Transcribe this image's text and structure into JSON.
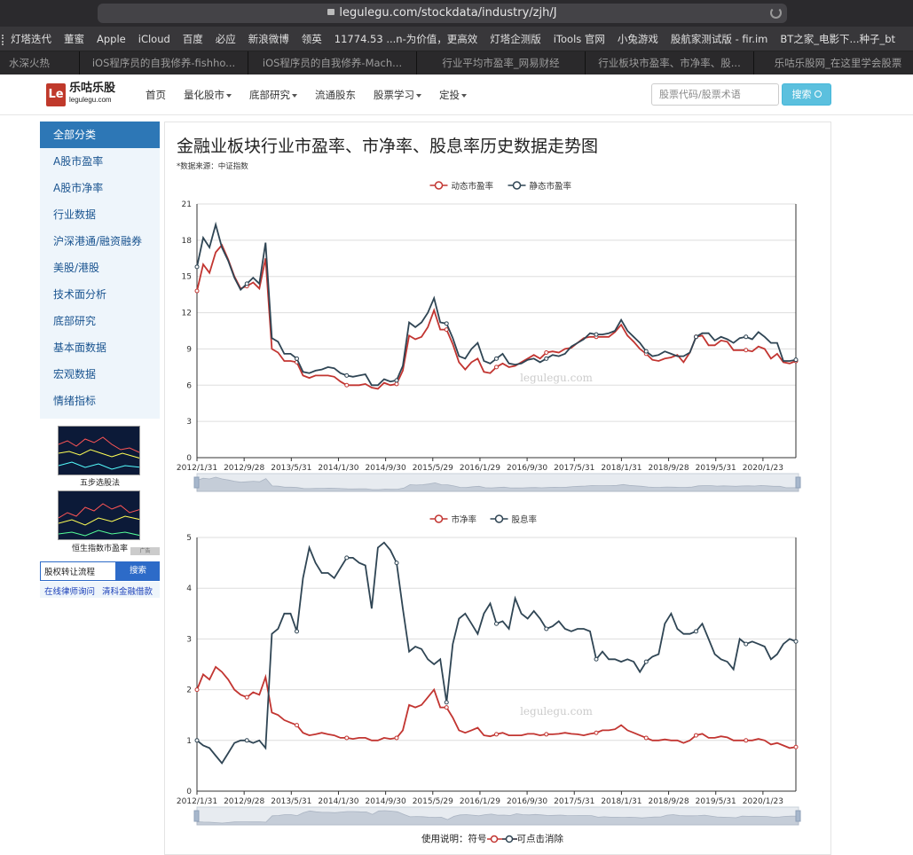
{
  "browser": {
    "url": "legulegu.com/stockdata/industry/zjh/J",
    "bookmarks": [
      "灯塔迭代",
      "董蜜",
      "Apple",
      "iCloud",
      "百度",
      "必应",
      "新浪微博",
      "领英",
      "11774.53 ...n-为价值，更高效",
      "灯塔企测版",
      "iTools 官网",
      "小兔游戏",
      "股航家测试版 - fir.im",
      "BT之家_电影下...种子_bt"
    ],
    "tabs": [
      "水深火热",
      "iOS程序员的自我修养-fishho...",
      "iOS程序员的自我修养-Mach...",
      "行业平均市盈率_网易财经",
      "行业板块市盈率、市净率、股...",
      "乐咕乐股网_在这里学会股票"
    ]
  },
  "site": {
    "logo_mark": "Le",
    "logo_text": "乐咕乐股",
    "logo_sub": "legulegu.com",
    "nav": [
      {
        "label": "首页"
      },
      {
        "label": "量化股市"
      },
      {
        "label": "底部研究"
      },
      {
        "label": "流通股东"
      },
      {
        "label": "股票学习"
      },
      {
        "label": "定投"
      }
    ],
    "search_placeholder": "股票代码/股票术语",
    "search_button": "搜索"
  },
  "sidebar": {
    "header": "全部分类",
    "items": [
      "A股市盈率",
      "A股市净率",
      "行业数据",
      "沪深港通/融资融券",
      "美股/港股",
      "技术面分析",
      "底部研究",
      "基本面数据",
      "宏观数据",
      "情绪指标"
    ],
    "ads": [
      {
        "caption": "五步选股法"
      },
      {
        "caption": "恒生指数市盈率"
      }
    ],
    "ad_badge": "广告",
    "search_input_value": "股权转让流程",
    "search_button": "搜索",
    "link1": "在线律师询问",
    "link2": "清科金融借款"
  },
  "main": {
    "title": "金融业板块行业市盈率、市净率、股息率历史数据走势图",
    "data_source": "*数据来源：中证指数",
    "watermark": "legulegu.com",
    "usage_note_prefix": "使用说明：符号",
    "usage_note_suffix": "可点击消除"
  },
  "colors": {
    "red": "#c23531",
    "dark": "#2f4554",
    "accent": "#2d77b6"
  },
  "chart_data": [
    {
      "type": "line",
      "title": "",
      "x_labels": [
        "2012/1/31",
        "2012/9/28",
        "2013/5/31",
        "2014/1/30",
        "2014/9/30",
        "2015/5/29",
        "2016/1/29",
        "2016/9/30",
        "2017/5/31",
        "2018/1/31",
        "2018/9/28",
        "2019/5/31",
        "2020/1/23"
      ],
      "ylim": [
        0,
        21
      ],
      "yticks": [
        0,
        3,
        6,
        9,
        12,
        15,
        18,
        21
      ],
      "legend_position": "top-center",
      "series": [
        {
          "name": "动态市盈率",
          "color": "#c23531",
          "values": [
            13.8,
            16.0,
            15.3,
            17.0,
            17.6,
            16.4,
            15.0,
            14.0,
            14.2,
            14.5,
            14.0,
            16.5,
            9.0,
            8.7,
            8.0,
            8.0,
            7.9,
            6.8,
            6.6,
            6.8,
            6.8,
            6.8,
            6.7,
            6.3,
            6.0,
            6.0,
            6.0,
            6.1,
            5.8,
            5.7,
            6.2,
            6.0,
            6.1,
            7.2,
            10.1,
            9.8,
            10.0,
            10.8,
            12.2,
            10.6,
            10.6,
            9.4,
            7.9,
            7.3,
            7.9,
            8.2,
            7.1,
            7.0,
            7.5,
            7.8,
            7.5,
            7.6,
            7.9,
            8.2,
            8.5,
            8.2,
            8.7,
            8.8,
            8.7,
            9.0,
            9.1,
            9.5,
            9.9,
            10.0,
            10.0,
            10.0,
            10.0,
            10.4,
            11.0,
            10.1,
            9.6,
            9.0,
            8.6,
            8.1,
            8.0,
            8.2,
            8.3,
            8.5,
            7.9,
            8.7,
            10.0,
            10.1,
            9.3,
            9.3,
            9.7,
            9.6,
            8.9,
            8.9,
            8.9,
            8.8,
            9.2,
            9.0,
            8.2,
            8.6,
            7.9,
            7.8,
            8.0
          ]
        },
        {
          "name": "静态市盈率",
          "color": "#2f4554",
          "values": [
            15.8,
            18.2,
            17.4,
            19.3,
            17.4,
            16.3,
            14.9,
            13.9,
            14.4,
            14.9,
            14.4,
            17.8,
            9.9,
            9.6,
            8.6,
            8.6,
            8.2,
            7.1,
            7.0,
            7.2,
            7.3,
            7.5,
            7.4,
            7.0,
            6.8,
            6.7,
            6.8,
            6.9,
            6.0,
            6.0,
            6.5,
            6.3,
            6.4,
            7.6,
            11.2,
            10.8,
            11.2,
            12.0,
            13.2,
            11.2,
            11.1,
            9.9,
            8.4,
            8.2,
            9.0,
            9.5,
            8.0,
            7.8,
            8.2,
            8.6,
            7.8,
            7.7,
            7.8,
            8.1,
            8.2,
            7.9,
            8.2,
            8.5,
            8.4,
            8.6,
            9.2,
            9.5,
            9.8,
            10.3,
            10.2,
            10.2,
            10.3,
            10.5,
            11.4,
            10.5,
            10.0,
            9.5,
            8.8,
            8.4,
            8.5,
            8.8,
            8.6,
            8.4,
            8.4,
            8.7,
            10.0,
            10.3,
            10.3,
            9.7,
            10.0,
            9.8,
            9.5,
            9.9,
            10.0,
            9.8,
            10.4,
            10.0,
            9.5,
            9.5,
            8.0,
            8.0,
            8.1
          ]
        }
      ]
    },
    {
      "type": "line",
      "title": "",
      "x_labels": [
        "2012/1/31",
        "2012/9/28",
        "2013/5/31",
        "2014/1/30",
        "2014/9/30",
        "2015/5/29",
        "2016/1/29",
        "2016/9/30",
        "2017/5/31",
        "2018/1/31",
        "2018/9/28",
        "2019/5/31",
        "2020/1/23"
      ],
      "ylim": [
        0,
        5
      ],
      "yticks": [
        0,
        1,
        2,
        3,
        4,
        5
      ],
      "legend_position": "top-center",
      "series": [
        {
          "name": "市净率",
          "color": "#c23531",
          "values": [
            2.0,
            2.3,
            2.2,
            2.45,
            2.35,
            2.2,
            2.0,
            1.9,
            1.85,
            1.95,
            1.9,
            2.25,
            1.55,
            1.5,
            1.4,
            1.35,
            1.3,
            1.15,
            1.1,
            1.12,
            1.15,
            1.12,
            1.1,
            1.05,
            1.05,
            1.03,
            1.05,
            1.05,
            1.0,
            1.0,
            1.05,
            1.03,
            1.05,
            1.2,
            1.7,
            1.65,
            1.7,
            1.85,
            2.0,
            1.65,
            1.65,
            1.45,
            1.2,
            1.15,
            1.2,
            1.25,
            1.1,
            1.08,
            1.12,
            1.15,
            1.1,
            1.1,
            1.1,
            1.13,
            1.13,
            1.1,
            1.12,
            1.12,
            1.13,
            1.15,
            1.13,
            1.12,
            1.1,
            1.13,
            1.15,
            1.2,
            1.2,
            1.22,
            1.3,
            1.2,
            1.15,
            1.1,
            1.05,
            1.0,
            1.0,
            1.02,
            1.0,
            1.0,
            0.95,
            1.0,
            1.1,
            1.13,
            1.05,
            1.05,
            1.08,
            1.06,
            1.0,
            1.0,
            1.0,
            1.0,
            1.03,
            1.0,
            0.92,
            0.95,
            0.9,
            0.85,
            0.87
          ]
        },
        {
          "name": "股息率",
          "color": "#2f4554",
          "values": [
            1.0,
            0.9,
            0.85,
            0.7,
            0.55,
            0.75,
            0.95,
            1.0,
            1.0,
            0.95,
            1.0,
            0.85,
            3.1,
            3.2,
            3.5,
            3.5,
            3.15,
            4.2,
            4.8,
            4.5,
            4.3,
            4.3,
            4.2,
            4.4,
            4.6,
            4.6,
            4.5,
            4.45,
            3.6,
            4.8,
            4.9,
            4.75,
            4.5,
            3.6,
            2.75,
            2.85,
            2.8,
            2.6,
            2.5,
            2.6,
            1.75,
            2.9,
            3.4,
            3.5,
            3.3,
            3.1,
            3.5,
            3.7,
            3.3,
            3.35,
            3.2,
            3.8,
            3.5,
            3.4,
            3.55,
            3.4,
            3.2,
            3.25,
            3.35,
            3.2,
            3.15,
            3.2,
            3.2,
            3.15,
            2.6,
            2.75,
            2.6,
            2.6,
            2.55,
            2.6,
            2.55,
            2.35,
            2.55,
            2.65,
            2.7,
            3.3,
            3.5,
            3.2,
            3.1,
            3.1,
            3.15,
            3.3,
            3.0,
            2.7,
            2.6,
            2.55,
            2.4,
            3.0,
            2.9,
            2.95,
            2.9,
            2.85,
            2.6,
            2.7,
            2.9,
            3.0,
            2.95
          ]
        }
      ]
    }
  ]
}
